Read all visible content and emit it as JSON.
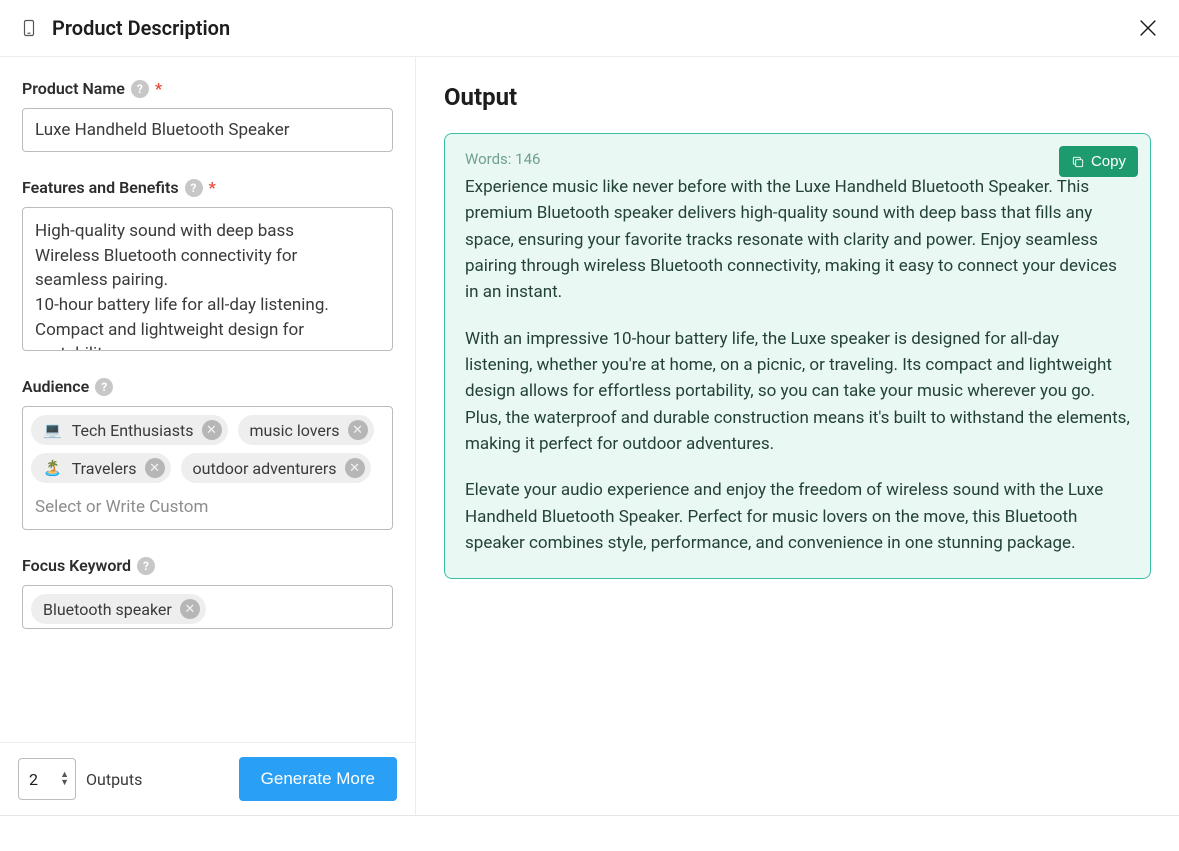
{
  "header": {
    "title": "Product Description"
  },
  "form": {
    "product_name": {
      "label": "Product Name",
      "value": "Luxe Handheld Bluetooth Speaker"
    },
    "features": {
      "label": "Features and Benefits",
      "value": "High-quality sound with deep bass\nWireless Bluetooth connectivity for seamless pairing.\n10-hour battery life for all-day listening.\nCompact and lightweight design for portability."
    },
    "audience": {
      "label": "Audience",
      "tags": [
        {
          "emoji": "💻",
          "label": "Tech Enthusiasts"
        },
        {
          "emoji": "",
          "label": "music lovers"
        },
        {
          "emoji": "🏝️",
          "label": "Travelers"
        },
        {
          "emoji": "",
          "label": "outdoor adventurers"
        }
      ],
      "placeholder": "Select or Write Custom"
    },
    "focus_keyword": {
      "label": "Focus Keyword",
      "tags": [
        {
          "label": "Bluetooth speaker"
        }
      ]
    }
  },
  "footer": {
    "outputs_value": "2",
    "outputs_label": "Outputs",
    "generate_label": "Generate More"
  },
  "output": {
    "title": "Output",
    "word_count_label": "Words: 146",
    "copy_label": "Copy",
    "paragraphs": [
      "Experience music like never before with the Luxe Handheld Bluetooth Speaker. This premium Bluetooth speaker delivers high-quality sound with deep bass that fills any space, ensuring your favorite tracks resonate with clarity and power. Enjoy seamless pairing through wireless Bluetooth connectivity, making it easy to connect your devices in an instant.",
      "With an impressive 10-hour battery life, the Luxe speaker is designed for all-day listening, whether you're at home, on a picnic, or traveling. Its compact and lightweight design allows for effortless portability, so you can take your music wherever you go. Plus, the waterproof and durable construction means it's built to withstand the elements, making it perfect for outdoor adventures.",
      "Elevate your audio experience and enjoy the freedom of wireless sound with the Luxe Handheld Bluetooth Speaker. Perfect for music lovers on the move, this Bluetooth speaker combines style, performance, and convenience in one stunning package."
    ]
  }
}
